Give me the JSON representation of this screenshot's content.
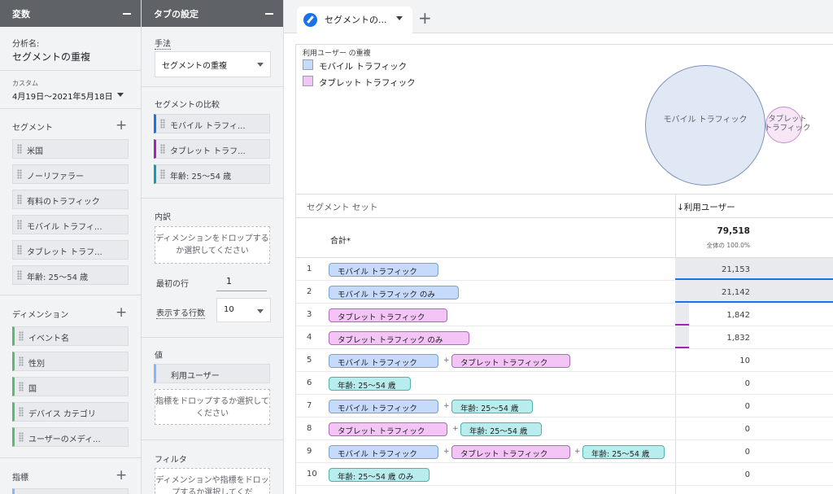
{
  "variables_panel": {
    "title": "変数",
    "analysis_name_label": "分析名:",
    "analysis_name": "セグメントの重複",
    "date_type": "カスタム",
    "date_range": "4月19日～2021年5月18日",
    "segments_label": "セグメント",
    "segments": [
      "米国",
      "ノーリファラー",
      "有料のトラフィック",
      "モバイル トラフィ...",
      "タブレット トラフ...",
      "年齢: 25～54 歳"
    ],
    "dimensions_label": "ディメンション",
    "dimensions": [
      "イベント名",
      "性別",
      "国",
      "デバイス カテゴリ",
      "ユーザーのメディ..."
    ],
    "metrics_label": "指標"
  },
  "tab_settings_panel": {
    "title": "タブの設定",
    "method_label": "手法",
    "method_value": "セグメントの重複",
    "compare_label": "セグメントの比較",
    "compare_items": [
      "モバイル トラフィ...",
      "タブレット トラフ...",
      "年齢: 25～54 歳"
    ],
    "breakdown_label": "内訳",
    "breakdown_drop": "ディメンションをドロップするか選択してください",
    "first_row_label": "最初の行",
    "first_row_value": "1",
    "rows_label": "表示する行数",
    "rows_value": "10",
    "values_label": "値",
    "values_item": "利用ユーザー",
    "values_drop": "指標をドロップするか選択してください",
    "filter_label": "フィルタ",
    "filter_drop": "ディメンションや指標をドロップするか選択してくだ"
  },
  "tabs": {
    "active": "セグメントの...",
    "add": "+"
  },
  "venn": {
    "title": "利用ユーザー の重複",
    "legend": [
      "モバイル トラフィック",
      "タブレット トラフィック"
    ],
    "labels": [
      "モバイル トラフィック",
      "タブレット トラフィック"
    ]
  },
  "table": {
    "col_segment": "セグメント セット",
    "col_users": "↓利用ユーザー",
    "total_label": "合計*",
    "total_value": "79,518",
    "total_pct": "全体の 100.0%",
    "rows": [
      {
        "n": "1",
        "value": "21,153",
        "frac": 0.9998
      },
      {
        "n": "2",
        "value": "21,142",
        "frac": 0.9993
      },
      {
        "n": "3",
        "value": "1,842",
        "frac": 0.087
      },
      {
        "n": "4",
        "value": "1,832",
        "frac": 0.0866
      },
      {
        "n": "5",
        "value": "10",
        "frac": 0
      },
      {
        "n": "6",
        "value": "0",
        "frac": 0
      },
      {
        "n": "7",
        "value": "0",
        "frac": 0
      },
      {
        "n": "8",
        "value": "0",
        "frac": 0
      },
      {
        "n": "9",
        "value": "0",
        "frac": 0
      },
      {
        "n": "10",
        "value": "0",
        "frac": 0
      }
    ],
    "pills": {
      "mobile": "モバイル トラフィック",
      "mobile_only": "モバイル トラフィック のみ",
      "tablet": "タブレット トラフィック",
      "tablet_only": "タブレット トラフィック のみ",
      "age": "年齢: 25～54 歳",
      "age_only": "年齢: 25～54 歳 のみ",
      "plus": "+"
    }
  }
}
